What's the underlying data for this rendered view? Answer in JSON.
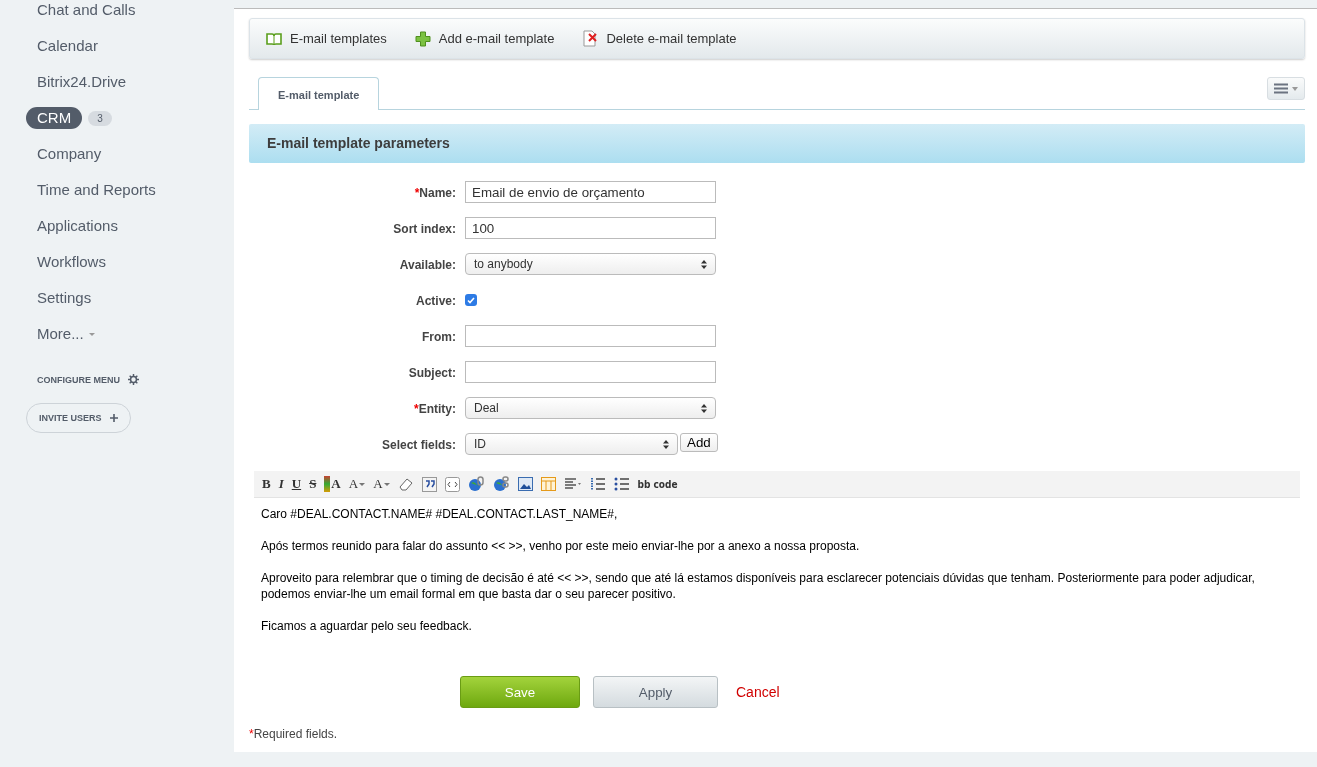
{
  "sidebar": {
    "items": [
      {
        "label": "Chat and Calls",
        "selected": false
      },
      {
        "label": "Calendar",
        "selected": false
      },
      {
        "label": "Bitrix24.Drive",
        "selected": false
      },
      {
        "label": "CRM",
        "selected": true,
        "counter": "3"
      },
      {
        "label": "Company",
        "selected": false
      },
      {
        "label": "Time and Reports",
        "selected": false
      },
      {
        "label": "Applications",
        "selected": false
      },
      {
        "label": "Workflows",
        "selected": false
      },
      {
        "label": "Settings",
        "selected": false
      },
      {
        "label": "More...",
        "selected": false,
        "dropdown": true
      }
    ],
    "configure": "CONFIGURE MENU",
    "invite": "INVITE USERS"
  },
  "toolbar": [
    {
      "kind": "list",
      "label": "E-mail templates"
    },
    {
      "kind": "add",
      "label": "Add e-mail template"
    },
    {
      "kind": "delete",
      "label": "Delete e-mail template"
    }
  ],
  "tabs": [
    {
      "label": "E-mail template",
      "selected": true
    }
  ],
  "section_title": "E-mail template parameters",
  "fields": [
    {
      "kind": "text",
      "label": "Name:",
      "required_mark": "*",
      "value": "Email de envio de orçamento"
    },
    {
      "kind": "text",
      "label": "Sort index:",
      "value": "100"
    },
    {
      "kind": "select",
      "label": "Available:",
      "value": "to anybody"
    },
    {
      "kind": "checkbox",
      "label": "Active:",
      "checked": true
    },
    {
      "kind": "text",
      "label": "From:"
    },
    {
      "kind": "text",
      "label": "Subject:"
    },
    {
      "kind": "select",
      "label": "Entity:",
      "required_mark": "*",
      "value": "Deal"
    },
    {
      "kind": "select_add",
      "label": "Select fields:",
      "value": "ID",
      "button": "Add"
    }
  ],
  "editor_toolbar": [
    {
      "kind": "bold",
      "label": "B"
    },
    {
      "kind": "italic",
      "label": "I"
    },
    {
      "kind": "underline",
      "label": "U"
    },
    {
      "kind": "strike",
      "label": "S"
    },
    {
      "kind": "color",
      "label": "A"
    },
    {
      "kind": "size",
      "label": "A"
    },
    {
      "kind": "font",
      "label": "A"
    },
    {
      "kind": "eraser"
    },
    {
      "kind": "quote"
    },
    {
      "kind": "code"
    },
    {
      "kind": "link"
    },
    {
      "kind": "unlink"
    },
    {
      "kind": "image"
    },
    {
      "kind": "table"
    },
    {
      "kind": "align"
    },
    {
      "kind": "ol"
    },
    {
      "kind": "ul"
    },
    {
      "kind": "bbcode",
      "label": "bb code"
    }
  ],
  "editor_paragraphs": [
    "Caro #DEAL.CONTACT.NAME# #DEAL.CONTACT.LAST_NAME#,",
    "Após termos reunido para falar do assunto << >>, venho por este meio enviar-lhe por a anexo a nossa proposta.",
    "Aproveito para relembrar que o timing de decisão é até << >>, sendo que até lá estamos disponíveis para esclarecer potenciais dúvidas que tenham. Posteriormente para poder adjudicar, podemos enviar-lhe um email formal em que basta dar o seu parecer positivo.",
    "Ficamos a aguardar pelo seu feedback."
  ],
  "buttons": [
    {
      "kind": "save",
      "label": "Save"
    },
    {
      "kind": "apply",
      "label": "Apply"
    },
    {
      "kind": "cancel",
      "label": "Cancel"
    }
  ],
  "required_note": {
    "mark": "*",
    "text": "Required fields."
  }
}
